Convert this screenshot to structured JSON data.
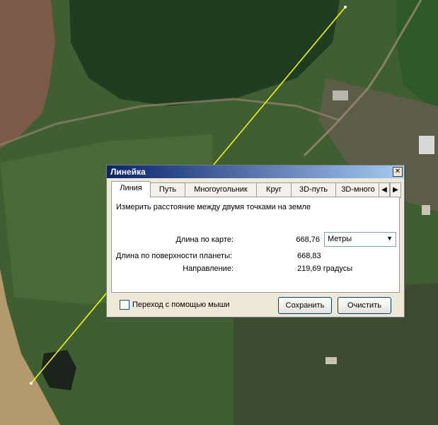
{
  "dialog": {
    "title": "Линейка",
    "close_glyph": "✕",
    "tabs": [
      "Линия",
      "Путь",
      "Многоугольник",
      "Круг",
      "3D-путь",
      "3D-много"
    ],
    "tab_scroll_left": "◀",
    "tab_scroll_right": "▶",
    "description": "Измерить расстояние между двумя точками на земле",
    "map_length_label": "Длина по карте:",
    "map_length_value": "668,76",
    "units_selected": "Метры",
    "surface_length_label": "Длина по поверхности планеты:",
    "surface_length_value": "668,83",
    "heading_label": "Направление:",
    "heading_value": "219,69 градусы",
    "mouse_nav_label": "Переход с помощью мыши",
    "mouse_nav_checked": false,
    "save_button": "Сохранить",
    "clear_button": "Очистить"
  },
  "map": {
    "measure_line_color": "#ffff00"
  }
}
